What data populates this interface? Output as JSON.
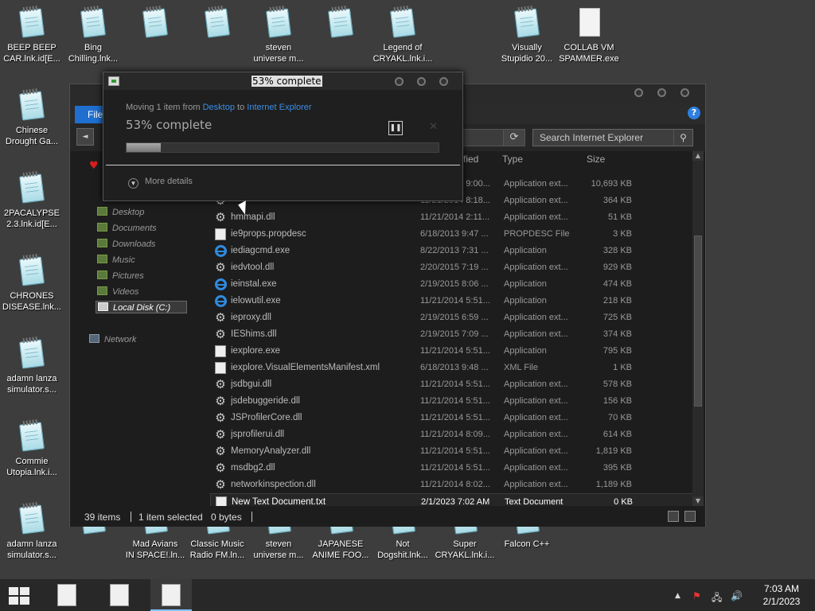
{
  "desktop": {
    "icons": [
      {
        "label": "BEEP BEEP\nCAR.lnk.id[E...",
        "type": "note"
      },
      {
        "label": "Bing\nChilling.lnk...",
        "type": "note"
      },
      {
        "label": "",
        "type": "note"
      },
      {
        "label": "",
        "type": "note"
      },
      {
        "label": "steven\nuniverse m...",
        "type": "note"
      },
      {
        "label": "",
        "type": "note"
      },
      {
        "label": "Legend of\nCRYAKL.lnk.i...",
        "type": "note"
      },
      {
        "label": "Visually\nStupidio 20...",
        "type": "note"
      },
      {
        "label": "COLLAB VM\nSPAMMER.exe",
        "type": "blank"
      },
      {
        "label": "Chinese\nDrought Ga...",
        "type": "note"
      },
      {
        "label": "2PACALYPSE\n2.3.lnk.id[E...",
        "type": "note"
      },
      {
        "label": "CHRONES\nDISEASE.lnk...",
        "type": "note"
      },
      {
        "label": "adamn lanza\nsimulator.s...",
        "type": "note"
      },
      {
        "label": "Commie\nUtopia.lnk.i...",
        "type": "note"
      },
      {
        "label": "adamn lanza\nsimulator.s...",
        "type": "note"
      },
      {
        "label": "",
        "type": "note"
      },
      {
        "label": "Mad Avians\nIN SPACE!.ln...",
        "type": "note"
      },
      {
        "label": "Classic Music\nRadio FM.ln...",
        "type": "note"
      },
      {
        "label": "steven\nuniverse m...",
        "type": "note"
      },
      {
        "label": "JAPANESE\nANIME FOO...",
        "type": "note"
      },
      {
        "label": "Not\nDogshit.lnk...",
        "type": "note"
      },
      {
        "label": "Super\nCRYAKL.lnk.i...",
        "type": "note"
      },
      {
        "label": "Falcon C++",
        "type": "note"
      }
    ]
  },
  "explorer": {
    "file_tab": "File",
    "search_placeholder": "Search Internet Explorer",
    "columns": {
      "modified": "fied",
      "type": "Type",
      "size": "Size"
    },
    "nav": [
      {
        "label": "Desktop"
      },
      {
        "label": "Documents"
      },
      {
        "label": "Downloads"
      },
      {
        "label": "Music"
      },
      {
        "label": "Pictures"
      },
      {
        "label": "Videos"
      },
      {
        "label": "Local Disk (C:)"
      },
      {
        "label": "Network"
      }
    ],
    "files": [
      {
        "name": "",
        "date": "11/21/2014 9:00...",
        "type": "Application ext...",
        "size": "10,693 KB",
        "icon": "dll"
      },
      {
        "name": "",
        "date": "11/21/2014 8:18...",
        "type": "Application ext...",
        "size": "364 KB",
        "icon": "dll"
      },
      {
        "name": "hmmapi.dll",
        "date": "11/21/2014 2:11...",
        "type": "Application ext...",
        "size": "51 KB",
        "icon": "dll"
      },
      {
        "name": "ie9props.propdesc",
        "date": "6/18/2013 9:47 ...",
        "type": "PROPDESC File",
        "size": "3 KB",
        "icon": "doc"
      },
      {
        "name": "iediagcmd.exe",
        "date": "8/22/2013 7:31 ...",
        "type": "Application",
        "size": "328 KB",
        "icon": "ie"
      },
      {
        "name": "iedvtool.dll",
        "date": "2/20/2015 7:19 ...",
        "type": "Application ext...",
        "size": "929 KB",
        "icon": "dll"
      },
      {
        "name": "ieinstal.exe",
        "date": "2/19/2015 8:06 ...",
        "type": "Application",
        "size": "474 KB",
        "icon": "ie"
      },
      {
        "name": "ielowutil.exe",
        "date": "11/21/2014 5:51...",
        "type": "Application",
        "size": "218 KB",
        "icon": "ie"
      },
      {
        "name": "ieproxy.dll",
        "date": "2/19/2015 6:59 ...",
        "type": "Application ext...",
        "size": "725 KB",
        "icon": "dll"
      },
      {
        "name": "IEShims.dll",
        "date": "2/19/2015 7:09 ...",
        "type": "Application ext...",
        "size": "374 KB",
        "icon": "dll"
      },
      {
        "name": "iexplore.exe",
        "date": "11/21/2014 5:51...",
        "type": "Application",
        "size": "795 KB",
        "icon": "doc"
      },
      {
        "name": "iexplore.VisualElementsManifest.xml",
        "date": "6/18/2013 9:48 ...",
        "type": "XML File",
        "size": "1 KB",
        "icon": "doc"
      },
      {
        "name": "jsdbgui.dll",
        "date": "11/21/2014 5:51...",
        "type": "Application ext...",
        "size": "578 KB",
        "icon": "dll"
      },
      {
        "name": "jsdebuggeride.dll",
        "date": "11/21/2014 5:51...",
        "type": "Application ext...",
        "size": "156 KB",
        "icon": "dll"
      },
      {
        "name": "JSProfilerCore.dll",
        "date": "11/21/2014 5:51...",
        "type": "Application ext...",
        "size": "70 KB",
        "icon": "dll"
      },
      {
        "name": "jsprofilerui.dll",
        "date": "11/21/2014 8:09...",
        "type": "Application ext...",
        "size": "614 KB",
        "icon": "dll"
      },
      {
        "name": "MemoryAnalyzer.dll",
        "date": "11/21/2014 5:51...",
        "type": "Application ext...",
        "size": "1,819 KB",
        "icon": "dll"
      },
      {
        "name": "msdbg2.dll",
        "date": "11/21/2014 5:51...",
        "type": "Application ext...",
        "size": "395 KB",
        "icon": "dll"
      },
      {
        "name": "networkinspection.dll",
        "date": "11/21/2014 8:02...",
        "type": "Application ext...",
        "size": "1,189 KB",
        "icon": "dll"
      },
      {
        "name": "New Text Document.txt",
        "date": "2/1/2023 7:02 AM",
        "type": "Text Document",
        "size": "0 KB",
        "icon": "doc",
        "selected": true
      }
    ],
    "status": {
      "items": "39 items",
      "selected": "1 item selected",
      "bytes": "0 bytes"
    }
  },
  "copy_dialog": {
    "title": "53% complete",
    "moving_prefix": "Moving 1 item from",
    "from": "Desktop",
    "to_word": "to",
    "to": "Internet Explorer",
    "percent_label": "53% complete",
    "progress": 0.11,
    "more_details": "More details"
  },
  "taskbar": {
    "time": "7:03 AM",
    "date": "2/1/2023"
  },
  "colors": {
    "accent": "#1e6fd0",
    "link": "#3a8ee6"
  }
}
